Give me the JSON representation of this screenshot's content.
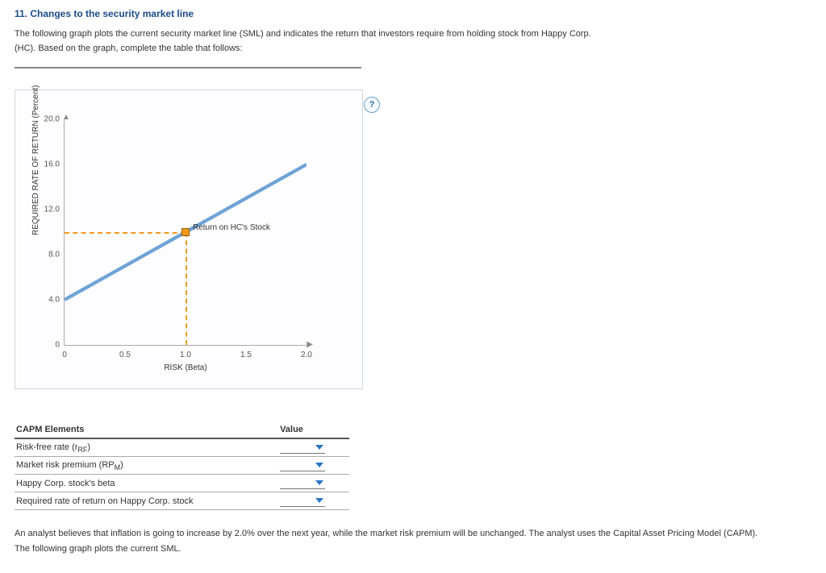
{
  "title": "11. Changes to the security market line",
  "intro_line1": "The following graph plots the current security market line (SML) and indicates the return that investors require from holding stock from Happy Corp.",
  "intro_line2": "(HC). Based on the graph, complete the table that follows:",
  "help_glyph": "?",
  "chart_data": {
    "type": "line",
    "xlabel": "RISK (Beta)",
    "ylabel": "REQUIRED RATE OF RETURN (Percent)",
    "x_ticks": [
      "0",
      "0.5",
      "1.0",
      "1.5",
      "2.0"
    ],
    "y_ticks": [
      "0",
      "4.0",
      "8.0",
      "12.0",
      "16.0",
      "20.0"
    ],
    "xlim": [
      0,
      2.0
    ],
    "ylim": [
      0,
      20.0
    ],
    "series": [
      {
        "name": "SML",
        "x": [
          0,
          2.0
        ],
        "y": [
          4.0,
          16.0
        ],
        "color": "#6fa3d6"
      }
    ],
    "marker": {
      "label": "Return on HC's Stock",
      "x": 1.0,
      "y": 10.0,
      "color": "#ee9a1f"
    },
    "guides": [
      {
        "axis": "y",
        "at": 10.0,
        "from_x": 0,
        "to_x": 1.0
      },
      {
        "axis": "x",
        "at": 1.0,
        "from_y": 0,
        "to_y": 10.0
      }
    ]
  },
  "table": {
    "headers": {
      "c1": "CAPM Elements",
      "c2": "Value"
    },
    "rows": [
      {
        "label_prefix": "Risk-free rate (r",
        "sub": "RF",
        "label_suffix": ")"
      },
      {
        "label_prefix": "Market risk premium (RP",
        "sub": "M",
        "label_suffix": ")"
      },
      {
        "label_prefix": "Happy Corp. stock's beta",
        "sub": "",
        "label_suffix": ""
      },
      {
        "label_prefix": "Required rate of return on Happy Corp. stock",
        "sub": "",
        "label_suffix": ""
      }
    ]
  },
  "followup": "An analyst believes that inflation is going to increase by 2.0% over the next year, while the market risk premium will be unchanged. The analyst uses the Capital Asset Pricing Model (CAPM). The following graph plots the current SML."
}
